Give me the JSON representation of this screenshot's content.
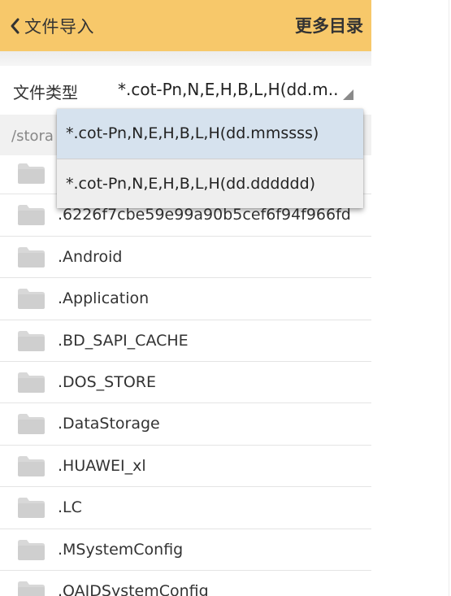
{
  "header": {
    "back_label": "文件导入",
    "more_label": "更多目录",
    "background": "#f7c86a"
  },
  "file_type": {
    "label": "文件类型",
    "selected_value": "*.cot-Pn,N,E,H,B,L,H(dd.m..",
    "options": [
      "*.cot-Pn,N,E,H,B,L,H(dd.mmssss)",
      "*.cot-Pn,N,E,H,B,L,H(dd.dddddd)"
    ]
  },
  "path": {
    "text": "/stora"
  },
  "files": [
    "",
    ".6226f7cbe59e99a90b5cef6f94f966fd",
    ".Android",
    ".Application",
    ".BD_SAPI_CACHE",
    ".DOS_STORE",
    ".DataStorage",
    ".HUAWEI_xl",
    ".LC",
    ".MSystemConfig",
    ".OAIDSystemConfig"
  ],
  "icons": {
    "back": "chevron-left-icon",
    "folder": "folder-icon",
    "dropdown": "dropdown-triangle-icon"
  }
}
